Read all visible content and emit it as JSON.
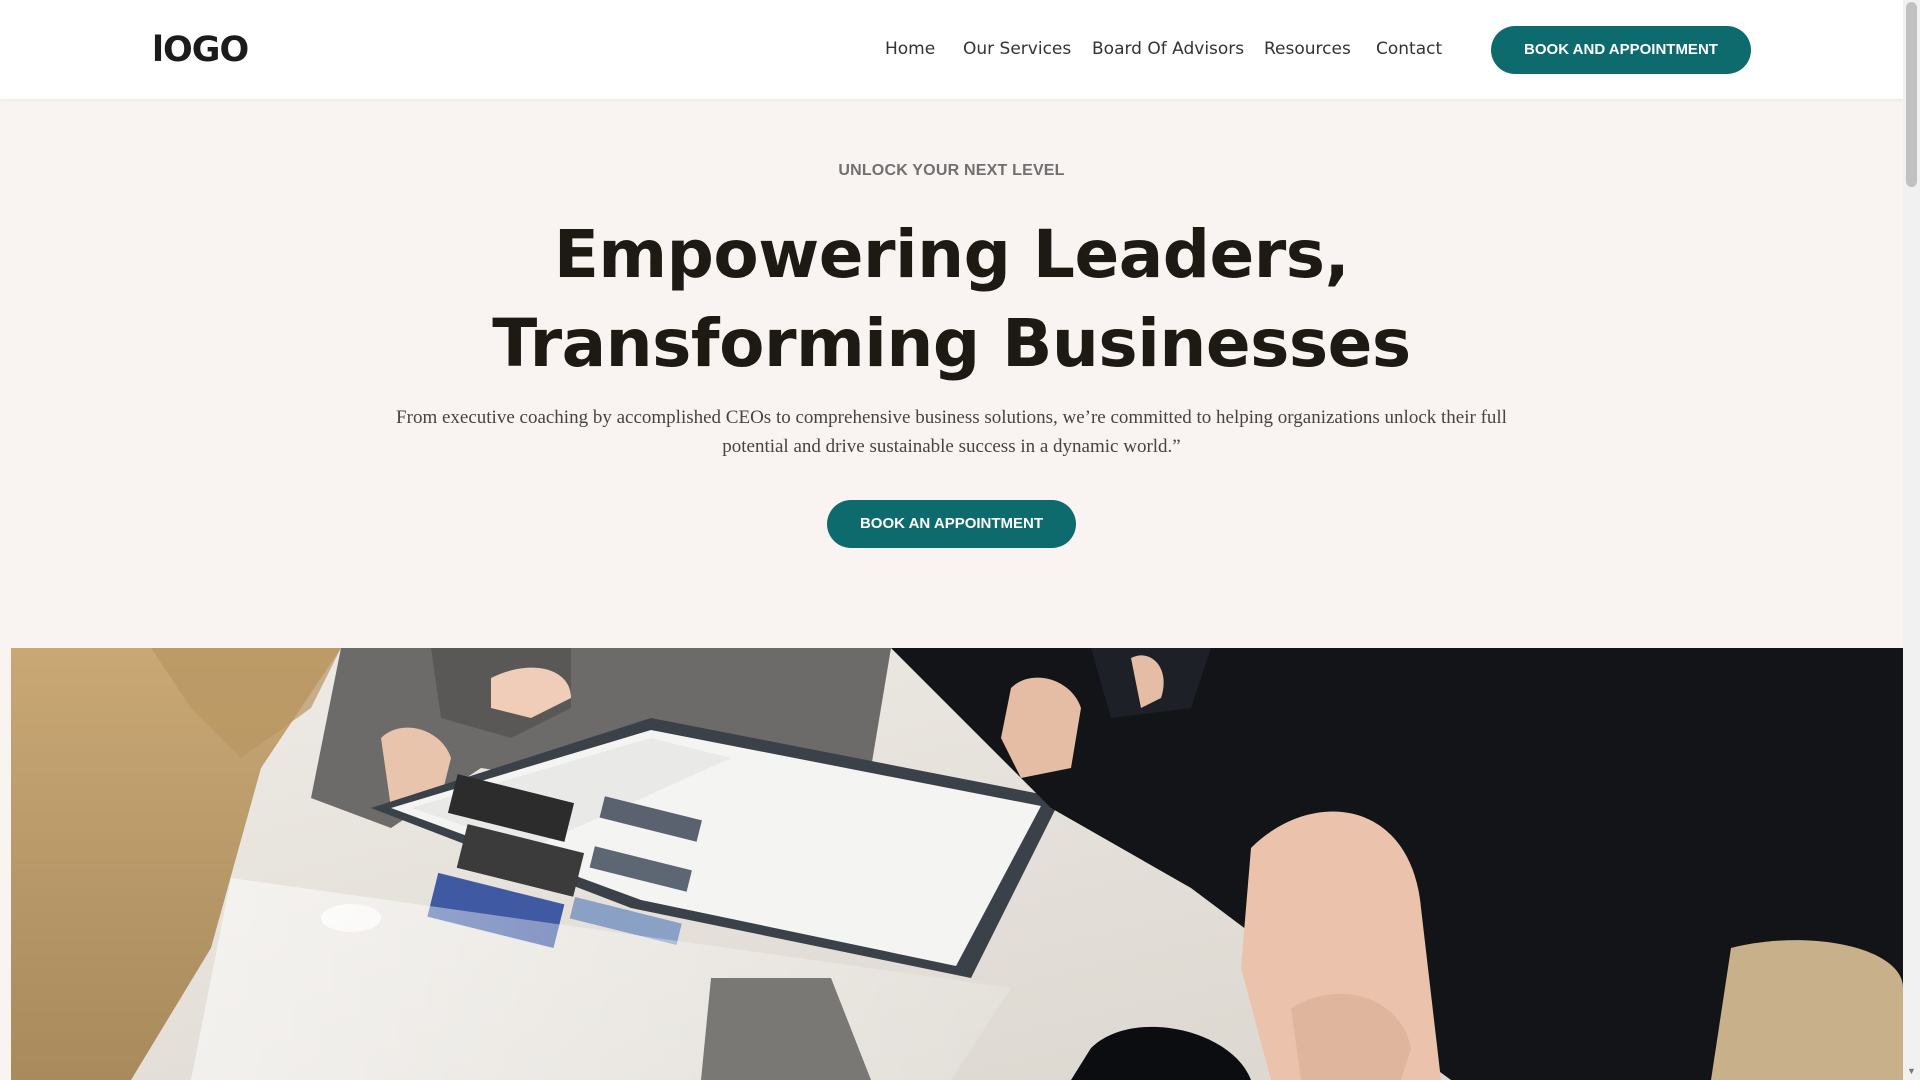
{
  "header": {
    "logo": "lOGO",
    "nav": [
      "Home",
      "Our Services",
      "Board Of Advisors",
      "Resources",
      "Contact"
    ],
    "cta_label": "BOOK AND APPOINTMENT"
  },
  "hero": {
    "eyebrow": "UNLOCK YOUR NEXT LEVEL",
    "headline_line1": "Empowering Leaders,",
    "headline_line2": "Transforming Businesses",
    "lede": "From executive coaching by accomplished CEOs to comprehensive business solutions, we’re committed to helping organizations unlock their full potential and drive sustainable success in a dynamic world.”",
    "cta_label": "BOOK AN APPOINTMENT"
  },
  "colors": {
    "accent": "#0e6b6d",
    "page_background": "#f9f3f1",
    "header_background": "#ffffff",
    "heading_text": "#1d1913"
  },
  "icons": {
    "scroll_down": "chevron-down-icon"
  }
}
